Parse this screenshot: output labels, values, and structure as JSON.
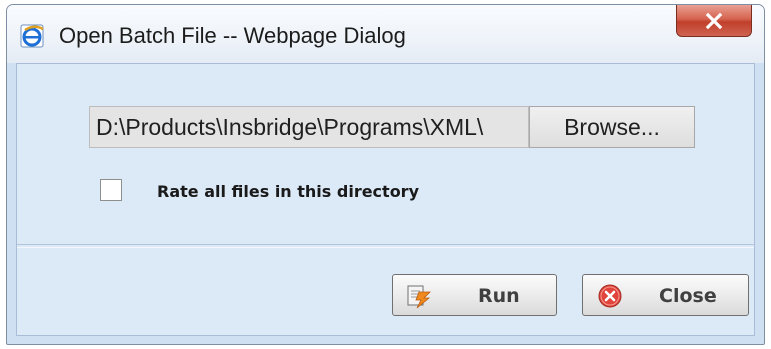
{
  "window": {
    "title": "Open Batch File -- Webpage Dialog",
    "title_icon": "ie-icon",
    "close_icon": "close-x-icon"
  },
  "form": {
    "file_path_value": "D:\\Products\\Insbridge\\Programs\\XML\\",
    "browse_label": "Browse...",
    "checkbox_checked": false,
    "checkbox_label": "Rate all files in this directory"
  },
  "buttons": {
    "run_label": "Run",
    "run_icon": "run-icon",
    "close_label": "Close",
    "close_icon": "close-circle-icon"
  },
  "colors": {
    "dialog_background": "#dce9f7",
    "title_close_red": "#c0402b"
  }
}
